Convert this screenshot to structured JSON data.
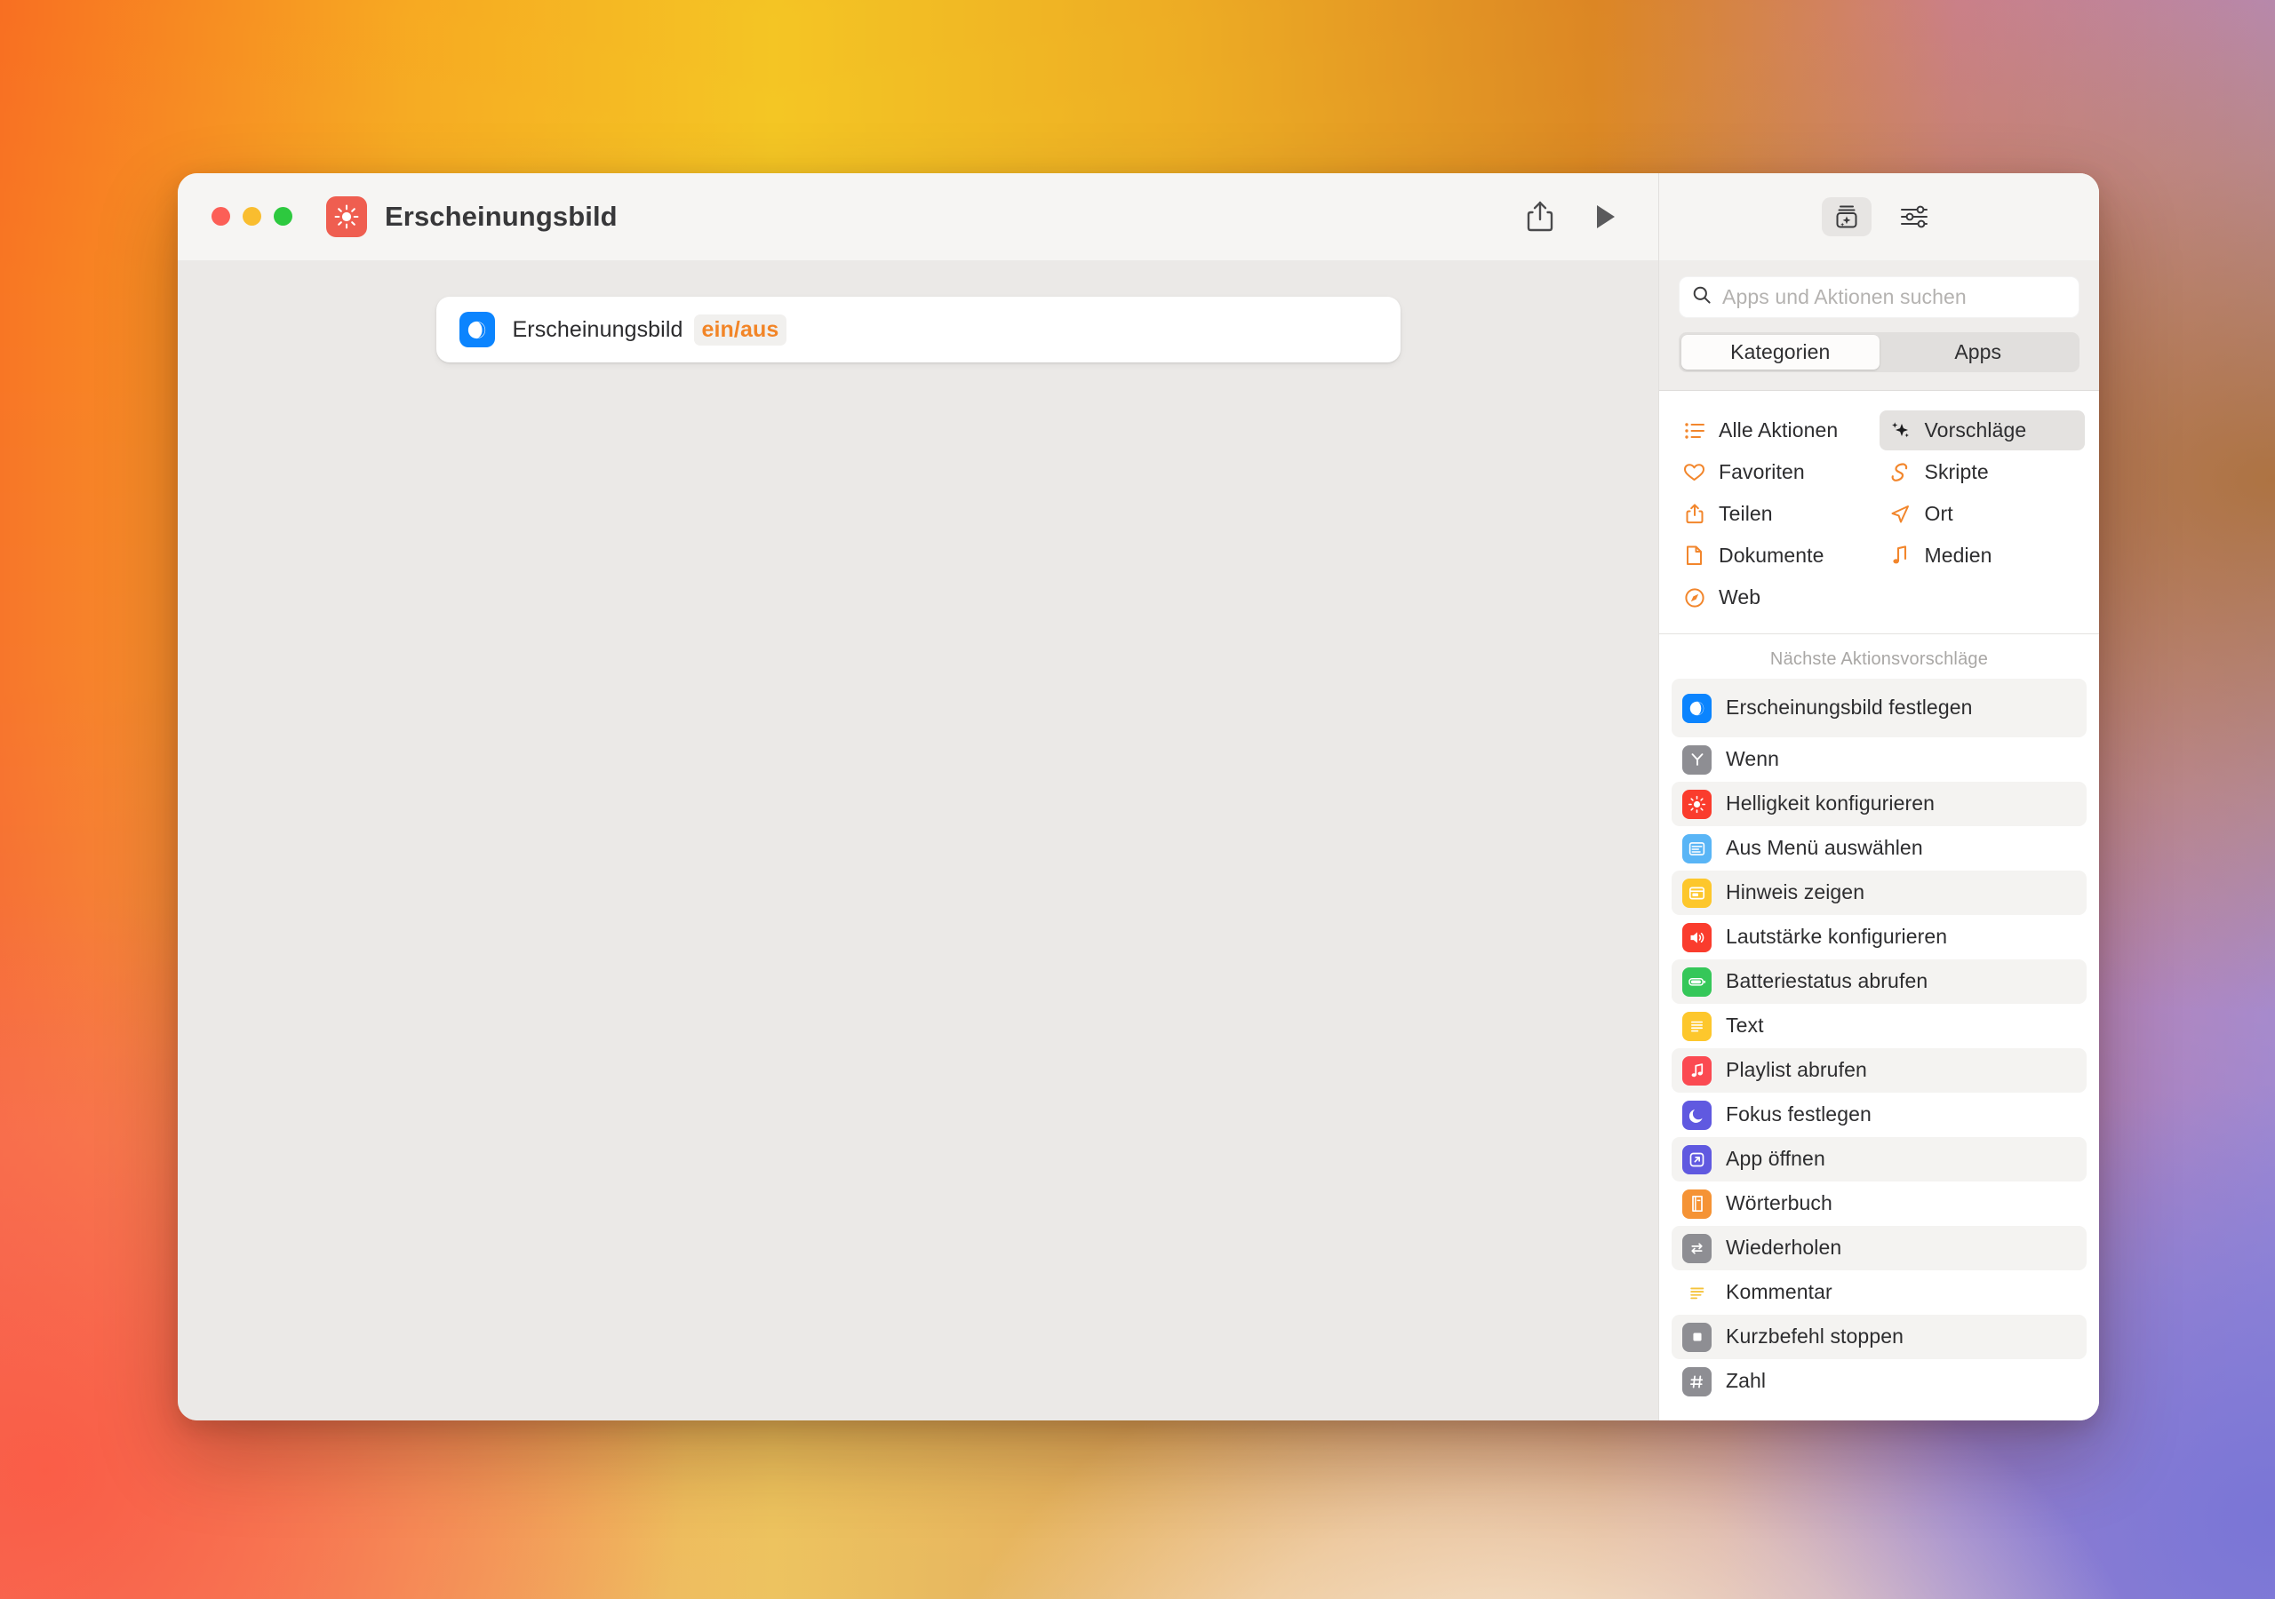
{
  "window": {
    "title": "Erscheinungsbild",
    "app_icon": "brightness-sun-icon",
    "traffic_lights": [
      "close",
      "minimize",
      "zoom"
    ]
  },
  "toolbar": {
    "share_label": "share-icon",
    "run_label": "play-icon",
    "library_label": "action-library-icon",
    "settings_label": "sliders-icon"
  },
  "canvas": {
    "action": {
      "icon": "appearance-icon",
      "title": "Erscheinungsbild",
      "parameter": "ein/aus",
      "parameter_color": "#f28527"
    }
  },
  "sidebar": {
    "search": {
      "placeholder": "Apps und Aktionen suchen",
      "value": "",
      "icon": "search-icon"
    },
    "segmented": {
      "options": [
        "Kategorien",
        "Apps"
      ],
      "selected": "Kategorien"
    },
    "categories": [
      {
        "label": "Alle Aktionen",
        "icon": "list-icon",
        "selected": false
      },
      {
        "label": "Vorschläge",
        "icon": "sparkles-icon",
        "selected": true
      },
      {
        "label": "Favoriten",
        "icon": "heart-icon",
        "selected": false
      },
      {
        "label": "Skripte",
        "icon": "script-icon",
        "selected": false
      },
      {
        "label": "Teilen",
        "icon": "share-icon",
        "selected": false
      },
      {
        "label": "Ort",
        "icon": "location-icon",
        "selected": false
      },
      {
        "label": "Dokumente",
        "icon": "document-icon",
        "selected": false
      },
      {
        "label": "Medien",
        "icon": "music-icon",
        "selected": false
      },
      {
        "label": "Web",
        "icon": "compass-icon",
        "selected": false
      }
    ],
    "suggestions_header": "Nächste Aktionsvorschläge",
    "suggestions": [
      {
        "label": "Erscheinungsbild festlegen",
        "icon": "appearance-icon",
        "color": "#0b84fe"
      },
      {
        "label": "Wenn",
        "icon": "branch-icon",
        "color": "#8e8e93"
      },
      {
        "label": "Helligkeit konfigurieren",
        "icon": "brightness-icon",
        "color": "#fa3c2d"
      },
      {
        "label": "Aus Menü auswählen",
        "icon": "menu-icon",
        "color": "#59b5f6"
      },
      {
        "label": "Hinweis zeigen",
        "icon": "alert-icon",
        "color": "#fdc72c"
      },
      {
        "label": "Lautstärke konfigurieren",
        "icon": "speaker-icon",
        "color": "#fa3c2d"
      },
      {
        "label": "Batteriestatus abrufen",
        "icon": "battery-icon",
        "color": "#35c759"
      },
      {
        "label": "Text",
        "icon": "text-icon",
        "color": "#fdc72c"
      },
      {
        "label": "Playlist abrufen",
        "icon": "music-note-icon",
        "color": "#fb4a52"
      },
      {
        "label": "Fokus festlegen",
        "icon": "moon-icon",
        "color": "#6059e0"
      },
      {
        "label": "App öffnen",
        "icon": "open-app-icon",
        "color": "#6059e0"
      },
      {
        "label": "Wörterbuch",
        "icon": "book-icon",
        "color": "#f59335"
      },
      {
        "label": "Wiederholen",
        "icon": "repeat-icon",
        "color": "#8e8e93"
      },
      {
        "label": "Kommentar",
        "icon": "comment-icon",
        "color": "transparent"
      },
      {
        "label": "Kurzbefehl stoppen",
        "icon": "stop-icon",
        "color": "#8e8e93"
      },
      {
        "label": "Zahl",
        "icon": "number-icon",
        "color": "#8e8e93"
      }
    ]
  }
}
